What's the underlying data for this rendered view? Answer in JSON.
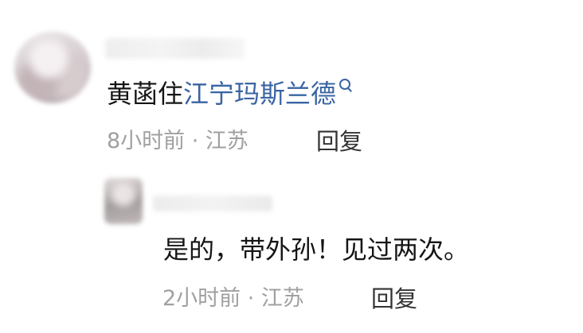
{
  "comment": {
    "text_plain": "黄菡住",
    "text_link": "江宁玛斯兰德",
    "search_icon": "search-icon",
    "meta": "8小时前 · 江苏",
    "reply_label": "回复"
  },
  "reply": {
    "text": "是的，带外孙！见过两次。",
    "meta": "2小时前 · 江苏",
    "reply_label": "回复"
  },
  "colors": {
    "link": "#3a64a3",
    "body_text": "#151515",
    "meta_text": "#a0a0a0"
  }
}
